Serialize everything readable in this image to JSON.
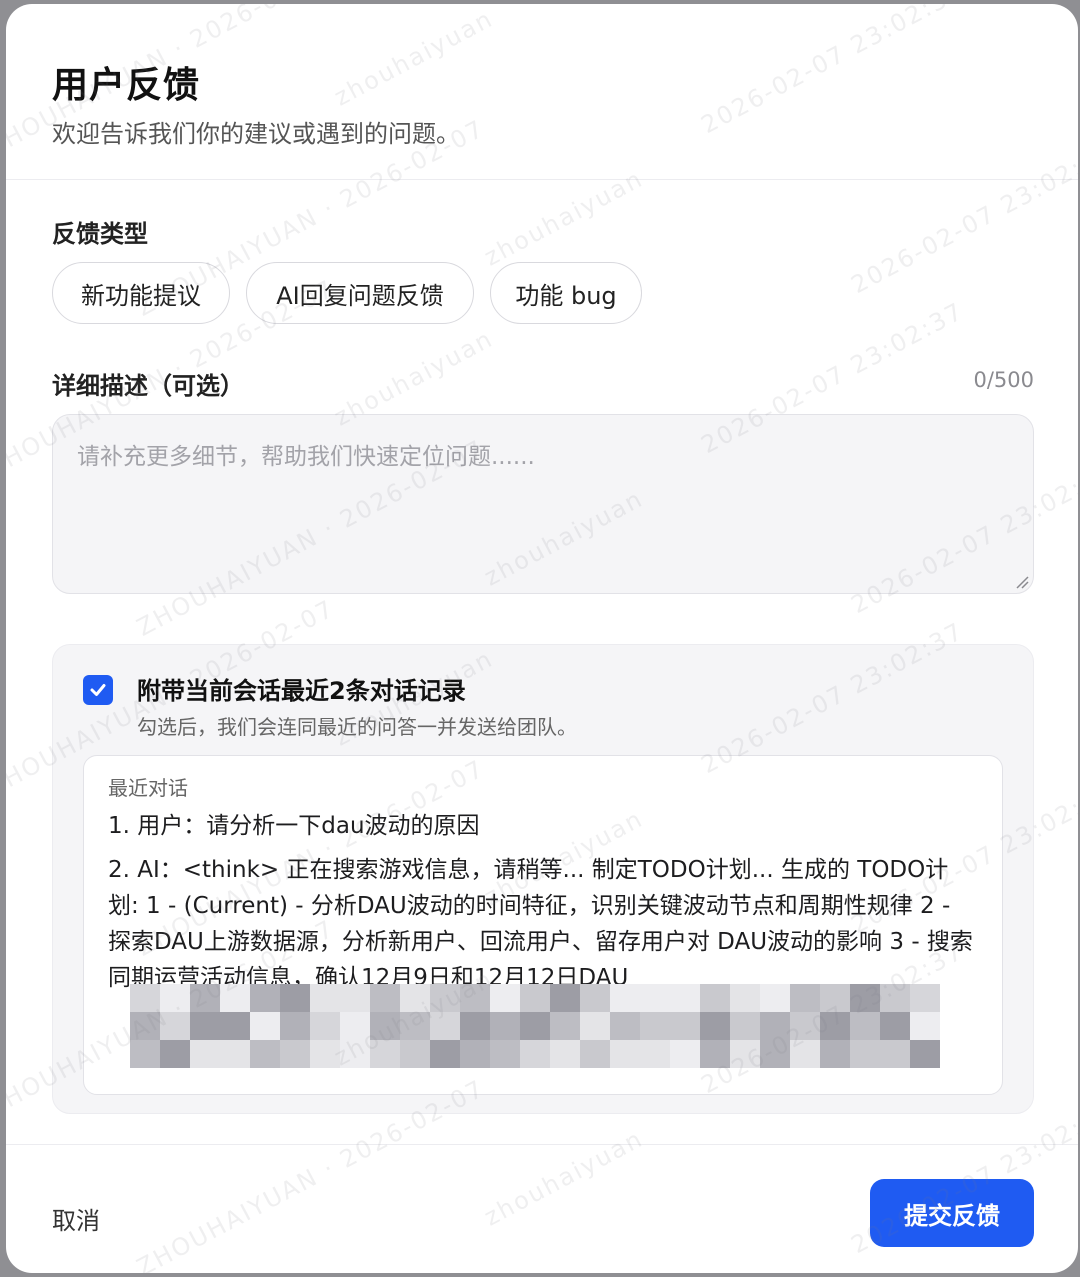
{
  "dialog": {
    "title": "用户反馈",
    "subtitle": "欢迎告诉我们你的建议或遇到的问题。"
  },
  "feedback_type": {
    "label": "反馈类型",
    "options": [
      "新功能提议",
      "AI回复问题反馈",
      "功能 bug"
    ]
  },
  "description": {
    "label": "详细描述（可选）",
    "counter": "0/500",
    "placeholder": "请补充更多细节，帮助我们快速定位问题......"
  },
  "attachment": {
    "checked": true,
    "title": "附带当前会话最近2条对话记录",
    "hint": "勾选后，我们会连同最近的问答一并发送给团队。",
    "history_label": "最近对话",
    "messages": [
      "1. 用户：请分析一下dau波动的原因",
      "2. AI：<think> 正在搜索游戏信息，请稍等... 制定TODO计划... 生成的 TODO计划: 1 - (Current) - 分析DAU波动的时间特征，识别关键波动节点和周期性规律 2 - 探索DAU上游数据源，分析新用户、回流用户、留存用户对 DAU波动的影响 3 - 搜索同期运营活动信息，确认12月9日和12月12日DAU"
    ]
  },
  "footer": {
    "cancel_label": "取消",
    "submit_label": "提交反馈"
  },
  "watermark": {
    "lines": [
      "ZHOUHAIYUAN · 2026-02-07",
      "zhouhaiyuan",
      "2026-02-07 23:02:37"
    ]
  },
  "colors": {
    "accent": "#1f5bf2",
    "panel_bg": "#f5f5f7",
    "border": "#e2e2e7"
  }
}
